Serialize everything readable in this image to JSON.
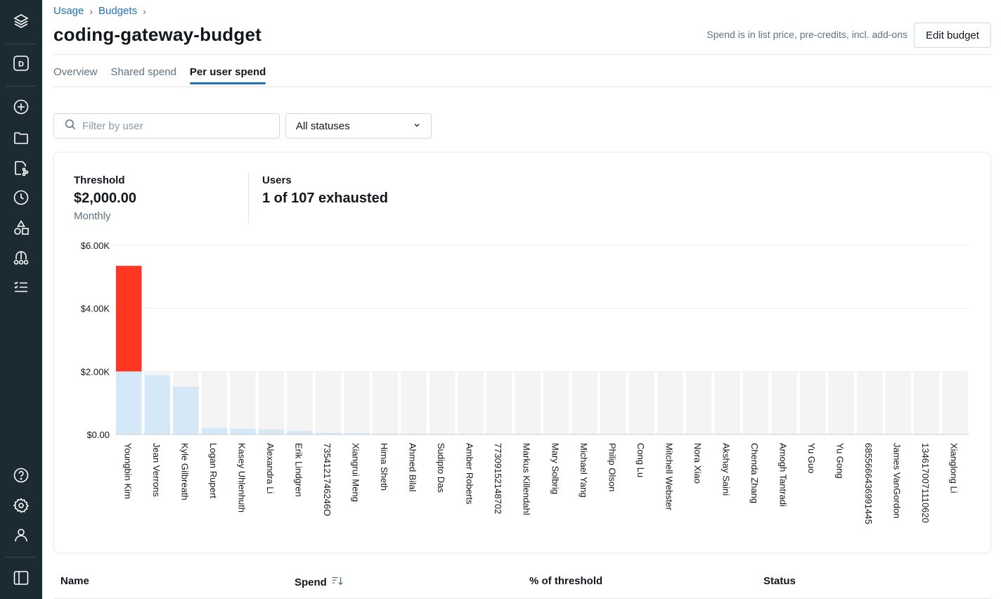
{
  "breadcrumb": [
    "Usage",
    "Budgets"
  ],
  "title": "coding-gateway-budget",
  "header_note": "Spend is in list price, pre-credits, incl. add-ons",
  "edit_button": "Edit budget",
  "tabs": [
    {
      "label": "Overview",
      "active": false
    },
    {
      "label": "Shared spend",
      "active": false
    },
    {
      "label": "Per user spend",
      "active": true
    }
  ],
  "filter": {
    "placeholder": "Filter by user",
    "value": ""
  },
  "status_select": {
    "value": "All statuses"
  },
  "stats": {
    "threshold": {
      "label": "Threshold",
      "value": "$2,000.00",
      "sub": "Monthly"
    },
    "users": {
      "label": "Users",
      "value": "1 of 107 exhausted"
    }
  },
  "colors": {
    "over": "#ff3621",
    "under": "#d5e8f8",
    "band": "#f4f4f4",
    "grid": "#ebeef1"
  },
  "chart_data": {
    "type": "bar",
    "title": "",
    "xlabel": "",
    "ylabel": "",
    "ylim": [
      0,
      6000
    ],
    "yticks": [
      "$0.00",
      "$2.00K",
      "$4.00K",
      "$6.00K"
    ],
    "ytick_values": [
      0,
      2000,
      4000,
      6000
    ],
    "threshold": 2000,
    "categories": [
      "Youngbin Kim",
      "Jean Verrons",
      "Kyle Gilbreath",
      "Logan Rupert",
      "Kasey Uhlenhuth",
      "Alexandra Li",
      "Erik Lindgren",
      "7354121746246O",
      "Xiangrui Meng",
      "Hima Sheth",
      "Ahmed Bilal",
      "Sudipto Das",
      "Amber Roberts",
      "77309152148702",
      "Markus Killendahl",
      "Mary Solbrig",
      "Michael Yang",
      "Philip Olson",
      "Cong Lu",
      "Mitchell Webster",
      "Nora Xiao",
      "Akshay Saini",
      "Chenda Zhang",
      "Amogh Tantradi",
      "Yu Guo",
      "Yu Gong",
      "6855666436991445",
      "James VanGordon",
      "1346170071110620",
      "Xianglong Li"
    ],
    "values": [
      5350,
      1880,
      1520,
      200,
      180,
      160,
      110,
      50,
      40,
      30,
      20,
      15,
      12,
      10,
      8,
      6,
      5,
      4,
      3,
      3,
      2,
      2,
      2,
      1,
      1,
      1,
      1,
      1,
      1,
      1
    ]
  },
  "table": {
    "columns": [
      "Name",
      "Spend",
      "% of threshold",
      "Status"
    ]
  }
}
